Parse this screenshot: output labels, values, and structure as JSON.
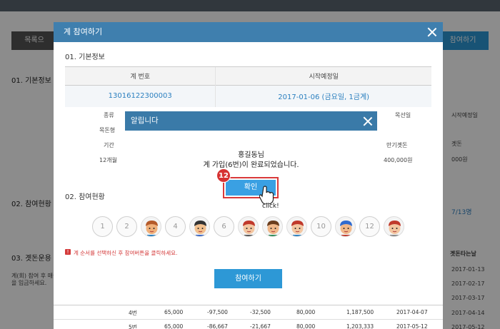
{
  "background": {
    "list_button": "목록으",
    "join_button": "참여하기",
    "sections": [
      "01. 기본정보",
      "02. 참여현황",
      "03. 곗돈운용"
    ],
    "side_texts": {
      "progress_count": "7/13명",
      "col_start": "시작예정일",
      "col_seond": "곗돈",
      "amount": "000원",
      "heading_date": "곗돈타는날",
      "note_lines": [
        "계(회) 참여 후 매월",
        "을 입금하세요."
      ]
    },
    "dates": [
      "2017-01-13",
      "2017-02-17",
      "2017-03-17",
      "2017-04-14",
      "2017-05-12"
    ],
    "rows": [
      [
        "4번",
        "65,000",
        "-97,500",
        "-32,500",
        "80,000",
        "1,187,500",
        "2017-04-07"
      ],
      [
        "5번",
        "65,000",
        "-86,667",
        "-21,667",
        "80,000",
        "1,203,333",
        "2017-05-12"
      ]
    ]
  },
  "modal": {
    "title": "계 참여하기",
    "section1": "01. 기본정보",
    "table": {
      "headers": [
        "계 번호",
        "시작예정일"
      ],
      "values": [
        "13016122300003",
        "2017-01-06 (금요일, 1금계)"
      ]
    },
    "left_labels": [
      "종류",
      "목돈형",
      "기간",
      "12개월"
    ],
    "right_labels": [
      "목선일",
      "만기곗돈",
      "400,000원"
    ],
    "section2": "02. 참여현황",
    "slots": [
      {
        "type": "num",
        "label": "1"
      },
      {
        "type": "num",
        "label": "2"
      },
      {
        "type": "face",
        "label": "3"
      },
      {
        "type": "num",
        "label": "4"
      },
      {
        "type": "face",
        "label": "5"
      },
      {
        "type": "num",
        "label": "6"
      },
      {
        "type": "face",
        "label": "7"
      },
      {
        "type": "face",
        "label": "8"
      },
      {
        "type": "face",
        "label": "9"
      },
      {
        "type": "num",
        "label": "10"
      },
      {
        "type": "face",
        "label": "11"
      },
      {
        "type": "num",
        "label": "12"
      },
      {
        "type": "face",
        "label": "13"
      }
    ],
    "notice": "계 순서를 선택하신 후 참여버튼을 클릭하세요.",
    "join_button": "참여하기"
  },
  "alert": {
    "title": "알립니다",
    "line1": "홍길동님",
    "line2": "계 가입(6번)이 완료되었습니다.",
    "ok_button": "확인",
    "step_badge": "12",
    "click_label": "click!"
  },
  "colors": {
    "modal_header": "#3f7fae",
    "alert_header": "#3a7aa8",
    "accent_button": "#2d98d6",
    "highlight": "#d93a3a"
  }
}
